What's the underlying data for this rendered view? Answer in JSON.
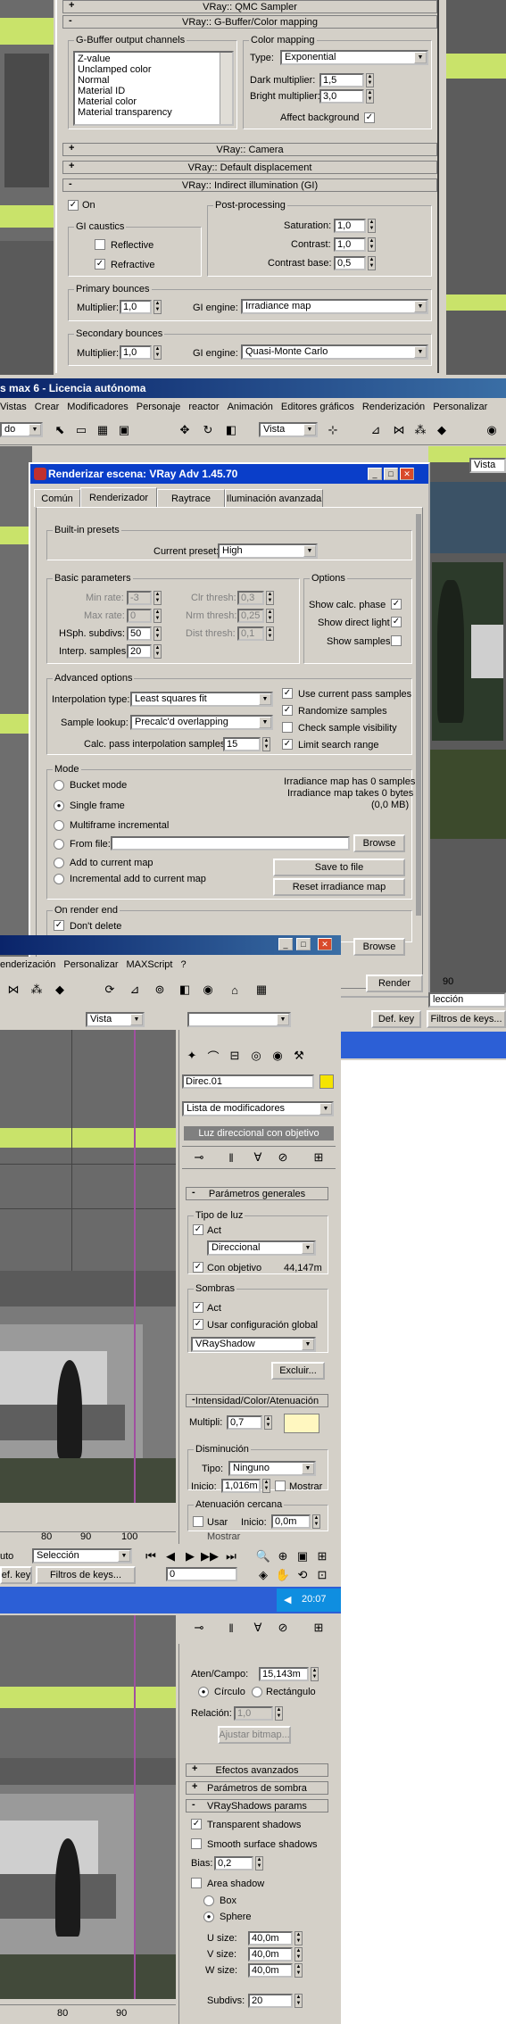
{
  "gbuffer": {
    "rollouts": [
      "VRay:: QMC Sampler",
      "VRay:: G-Buffer/Color mapping",
      "VRay:: Camera",
      "VRay:: Default displacement",
      "VRay:: Indirect illumination (GI)"
    ],
    "output_label": "G-Buffer output channels",
    "channels": [
      "Z-value",
      "Unclamped color",
      "Normal",
      "Material ID",
      "Material color",
      "Material transparency"
    ],
    "cm_label": "Color mapping",
    "type_label": "Type:",
    "type_value": "Exponential",
    "dark_label": "Dark multiplier:",
    "dark_value": "1,5",
    "bright_label": "Bright multiplier:",
    "bright_value": "3,0",
    "affect_label": "Affect background"
  },
  "gi": {
    "on_label": "On",
    "caustics_label": "GI caustics",
    "reflective": "Reflective",
    "refractive": "Refractive",
    "pp_label": "Post-processing",
    "sat_label": "Saturation:",
    "sat_value": "1,0",
    "con_label": "Contrast:",
    "con_value": "1,0",
    "cb_label": "Contrast base:",
    "cb_value": "0,5",
    "primary_label": "Primary bounces",
    "mult_label": "Multiplier:",
    "mult1": "1,0",
    "engine_label": "GI engine:",
    "engine1": "Irradiance map",
    "secondary_label": "Secondary bounces",
    "mult2": "1,0",
    "engine2": "Quasi-Monte Carlo"
  },
  "main_window": {
    "title": "s max 6 - Licencia autónoma",
    "menu": [
      "Vistas",
      "Crear",
      "Modificadores",
      "Personaje",
      "reactor",
      "Animación",
      "Editores gráficos",
      "Renderización",
      "Personalizar"
    ],
    "do_label": "do",
    "vista": "Vista",
    "vista2": "Vista"
  },
  "render_dialog": {
    "title": "Renderizar escena: VRay Adv 1.45.70",
    "tabs": [
      "Común",
      "Renderizador",
      "Raytrace",
      "Iluminación avanzada"
    ],
    "builtin_label": "Built-in presets",
    "preset_label": "Current preset:",
    "preset_value": "High",
    "basic_label": "Basic parameters",
    "minrate_label": "Min rate:",
    "minrate": "-3",
    "maxrate_label": "Max rate:",
    "maxrate": "0",
    "hsph_label": "HSph. subdivs:",
    "hsph": "50",
    "interp_label": "Interp. samples:",
    "interp": "20",
    "clr_label": "Clr thresh:",
    "clr": "0,3",
    "nrm_label": "Nrm thresh:",
    "nrm": "0,25",
    "dist_label": "Dist thresh:",
    "dist": "0,1",
    "options_label": "Options",
    "show_calc": "Show calc. phase",
    "show_direct": "Show direct light",
    "show_samples": "Show samples",
    "adv_label": "Advanced options",
    "itype_label": "Interpolation type:",
    "itype": "Least squares fit",
    "lookup_label": "Sample lookup:",
    "lookup": "Precalc'd overlapping",
    "calc_label": "Calc. pass interpolation samples:",
    "calc": "15",
    "use_current": "Use current pass samples",
    "randomize": "Randomize samples",
    "check_vis": "Check sample visibility",
    "limit": "Limit search range",
    "mode_label": "Mode",
    "modes": [
      "Bucket mode",
      "Single frame",
      "Multiframe incremental",
      "From file:",
      "Add to current map",
      "Incremental add to current map"
    ],
    "irr_info": [
      "Irradiance map has 0 samples",
      "Irradiance map takes 0 bytes",
      "(0,0 MB)"
    ],
    "browse": "Browse",
    "save": "Save to file",
    "reset": "Reset irradiance map",
    "onrender_label": "On render end",
    "dont_delete": "Don't delete",
    "browse2": "Browse",
    "render": "Render",
    "seleccion": "lección",
    "defkey": "Def. key",
    "filtros": "Filtros de keys...",
    "num90": "90"
  },
  "modify_panel": {
    "menu": [
      "enderización",
      "Personalizar",
      "MAXScript",
      "?"
    ],
    "vista": "Vista",
    "obj_name": "Direc.01",
    "modlist": "Lista de modificadores",
    "stack_item": "Luz direccional con objetivo",
    "general_params": "Parámetros generales",
    "light_type": "Tipo de luz",
    "act": "Act",
    "type_value": "Direccional",
    "con_objetivo": "Con objetivo",
    "target_dist": "44,147m",
    "sombras": "Sombras",
    "act2": "Act",
    "usar_global": "Usar configuración global",
    "shadow_type": "VRayShadow",
    "excluir": "Excluir...",
    "intensity": "Intensidad/Color/Atenuación",
    "multipli_label": "Multipli:",
    "multipli": "0,7",
    "disminucion": "Disminución",
    "tipo_label": "Tipo:",
    "tipo": "Ninguno",
    "inicio_label": "Inicio:",
    "inicio": "1,016m",
    "mostrar": "Mostrar",
    "aten_cercana": "Atenuación cercana",
    "usar": "Usar",
    "inicio2_label": "Inicio:",
    "inicio2": "0,0m",
    "mostrar2": "Mostrar",
    "timeline_labels": [
      "uto",
      "Selección",
      "ef. key",
      "Filtros de keys..."
    ],
    "frame": "0",
    "tick80": "80",
    "tick90": "90",
    "tick100": "100"
  },
  "taskbar": {
    "time": "20:07"
  },
  "shadow_panel": {
    "aten_campo_label": "Aten/Campo:",
    "aten_campo": "15,143m",
    "circulo": "Círculo",
    "rectangulo": "Rectángulo",
    "relacion_label": "Relación:",
    "relacion": "1,0",
    "ajustar": "Ajustar bitmap...",
    "efectos": "Efectos avanzados",
    "param_sombra": "Parámetros de sombra",
    "vrayshadows": "VRayShadows params",
    "transparent": "Transparent shadows",
    "smooth": "Smooth surface shadows",
    "bias_label": "Bias:",
    "bias": "0,2",
    "area": "Area shadow",
    "box": "Box",
    "sphere": "Sphere",
    "u_label": "U size:",
    "u": "40,0m",
    "v_label": "V size:",
    "v": "40,0m",
    "w_label": "W size:",
    "w": "40,0m",
    "subdivs_label": "Subdivs:",
    "subdivs": "20",
    "tick80": "80",
    "tick90": "90"
  }
}
